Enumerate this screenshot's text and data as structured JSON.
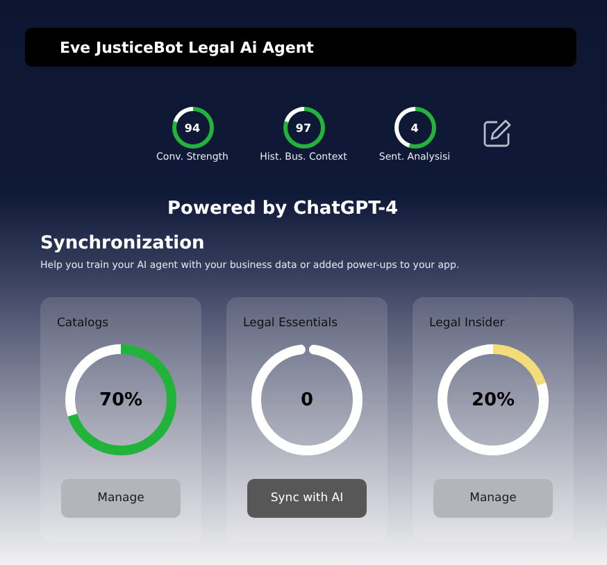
{
  "header": {
    "title": "Eve JusticeBot Legal Ai Agent"
  },
  "stats": [
    {
      "value": "94",
      "label": "Conv. Strength"
    },
    {
      "value": "97",
      "label": "Hist. Bus. Context"
    },
    {
      "value": "4",
      "label": "Sent. Analysisi"
    }
  ],
  "powered_by": "Powered by ChatGPT-4",
  "section": {
    "title": "Synchronization",
    "subtitle": "Help you train your AI agent with your business data or added power-ups to your app."
  },
  "cards": [
    {
      "title": "Catalogs",
      "reading": "70%",
      "color": "#22b33a",
      "button": {
        "label": "Manage",
        "kind": "light"
      }
    },
    {
      "title": "Legal Essentials",
      "reading": "0",
      "button": {
        "label": "Sync with AI",
        "kind": "dark"
      }
    },
    {
      "title": "Legal Insider",
      "reading": "20%",
      "color": "#f5dc7a",
      "button": {
        "label": "Manage",
        "kind": "light"
      }
    }
  ]
}
